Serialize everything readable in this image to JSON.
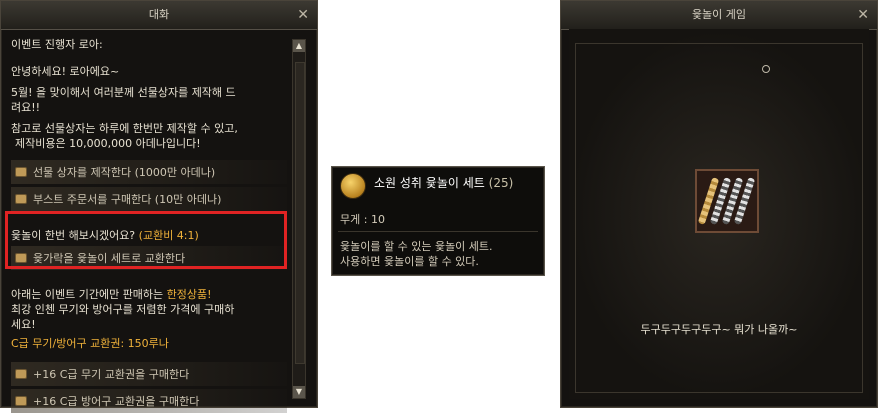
{
  "dialog": {
    "title": "대화",
    "close": "✕",
    "speaker": "이벤트 진행자 로아:",
    "greeting": "안녕하세요! 로아에요~",
    "para1_line1": "5월! 을 맞이해서 여러분께 선물상자를 제작해 드",
    "para1_line2": "려요!!",
    "para2_line1": "참고로 선물상자는 하루에 한번만 제작할 수 있고,",
    "para2_line2": "제작비용은 10,000,000 아데나입니다!",
    "options_top": [
      {
        "label": "선물 상자를 제작한다 (1000만 아데나)"
      },
      {
        "label": "부스트 주문서를 구매한다 (10만 아데나)"
      }
    ],
    "yut_question": "윷놀이 한번 해보시겠어요?",
    "yut_rate": "(교환비 4:1)",
    "yut_option": "윷가락을 윷놀이 세트로 교환한다",
    "promo_line1_a": "아래는  이벤트 기간에만 판매하는",
    "promo_line1_b": "한정상품!",
    "promo_line2": "최강 인첸 무기와 방어구를 저렴한 가격에 구매하",
    "promo_line3": "세요!",
    "price_line": "C급 무기/방어구 교환권: 150루나",
    "options_bottom": [
      {
        "label": "+16 C급 무기 교환권을 구매한다"
      },
      {
        "label": "+16 C급 방어구 교환권을 구매한다"
      }
    ],
    "scroll_up": "▲",
    "scroll_down": "▼"
  },
  "tooltip": {
    "item_name": "소원 성취 윷놀이 세트",
    "count": "(25)",
    "weight": "무게 : 10",
    "desc_line1": "윷놀이를 할 수 있는 윷놀이 세트.",
    "desc_line2": "사용하면 윷놀이를 할 수 있다."
  },
  "game": {
    "title": "윷놀이 게임",
    "close": "✕",
    "message": "두구두구두구두구~ 뭐가 나올까~"
  },
  "colors": {
    "highlight": "#f0b23a",
    "red_box": "#e02323",
    "panel_bg": "#141210"
  }
}
